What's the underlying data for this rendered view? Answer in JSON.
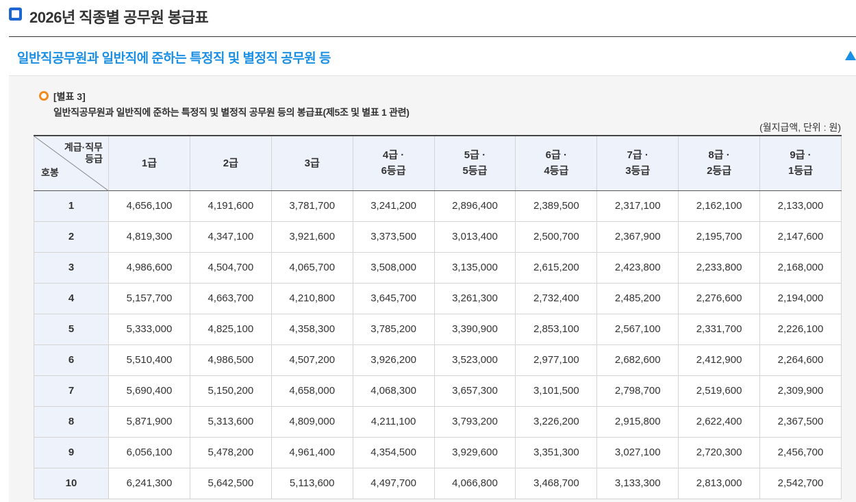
{
  "page": {
    "title": "2026년 직종별 공무원 봉급표"
  },
  "section": {
    "title": "일반직공무원과 일반직에 준하는 특정직 및 별정직 공무원 등",
    "toggle_icon": "triangle-up-icon",
    "accent_color": "#1a8fe3"
  },
  "table_info": {
    "number": "[별표 3]",
    "description": "일반직공무원과 일반직에 준하는 특정직 및 별정직 공무원 등의 봉급표(제5조 및 별표 1 관련)",
    "unit": "(월지급액, 단위 : 원)"
  },
  "table": {
    "corner_top_line1": "계급·직무",
    "corner_top_line2": "등급",
    "corner_bottom": "호봉",
    "columns": [
      {
        "line1": "1급",
        "line2": ""
      },
      {
        "line1": "2급",
        "line2": ""
      },
      {
        "line1": "3급",
        "line2": ""
      },
      {
        "line1": "4급 ·",
        "line2": "6등급"
      },
      {
        "line1": "5급 ·",
        "line2": "5등급"
      },
      {
        "line1": "6급 ·",
        "line2": "4등급"
      },
      {
        "line1": "7급 ·",
        "line2": "3등급"
      },
      {
        "line1": "8급 ·",
        "line2": "2등급"
      },
      {
        "line1": "9급 ·",
        "line2": "1등급"
      }
    ],
    "rows": [
      {
        "step": "1",
        "values": [
          "4,656,100",
          "4,191,600",
          "3,781,700",
          "3,241,200",
          "2,896,400",
          "2,389,500",
          "2,317,100",
          "2,162,100",
          "2,133,000"
        ]
      },
      {
        "step": "2",
        "values": [
          "4,819,300",
          "4,347,100",
          "3,921,600",
          "3,373,500",
          "3,013,400",
          "2,500,700",
          "2,367,900",
          "2,195,700",
          "2,147,600"
        ]
      },
      {
        "step": "3",
        "values": [
          "4,986,600",
          "4,504,700",
          "4,065,700",
          "3,508,000",
          "3,135,000",
          "2,615,200",
          "2,423,800",
          "2,233,800",
          "2,168,000"
        ]
      },
      {
        "step": "4",
        "values": [
          "5,157,700",
          "4,663,700",
          "4,210,800",
          "3,645,700",
          "3,261,300",
          "2,732,400",
          "2,485,200",
          "2,276,600",
          "2,194,000"
        ]
      },
      {
        "step": "5",
        "values": [
          "5,333,000",
          "4,825,100",
          "4,358,300",
          "3,785,200",
          "3,390,900",
          "2,853,100",
          "2,567,100",
          "2,331,700",
          "2,226,100"
        ]
      },
      {
        "step": "6",
        "values": [
          "5,510,400",
          "4,986,500",
          "4,507,200",
          "3,926,200",
          "3,523,000",
          "2,977,100",
          "2,682,600",
          "2,412,900",
          "2,264,600"
        ]
      },
      {
        "step": "7",
        "values": [
          "5,690,400",
          "5,150,200",
          "4,658,000",
          "4,068,300",
          "3,657,300",
          "3,101,500",
          "2,798,700",
          "2,519,600",
          "2,309,900"
        ]
      },
      {
        "step": "8",
        "values": [
          "5,871,900",
          "5,313,600",
          "4,809,000",
          "4,211,100",
          "3,793,200",
          "3,226,200",
          "2,915,800",
          "2,622,400",
          "2,367,500"
        ]
      },
      {
        "step": "9",
        "values": [
          "6,056,100",
          "5,478,200",
          "4,961,400",
          "4,354,500",
          "3,929,600",
          "3,351,300",
          "3,027,100",
          "2,720,300",
          "2,456,700"
        ]
      },
      {
        "step": "10",
        "values": [
          "6,241,300",
          "5,642,500",
          "5,113,600",
          "4,497,700",
          "4,066,800",
          "3,468,700",
          "3,133,300",
          "2,813,000",
          "2,542,700"
        ]
      }
    ]
  }
}
